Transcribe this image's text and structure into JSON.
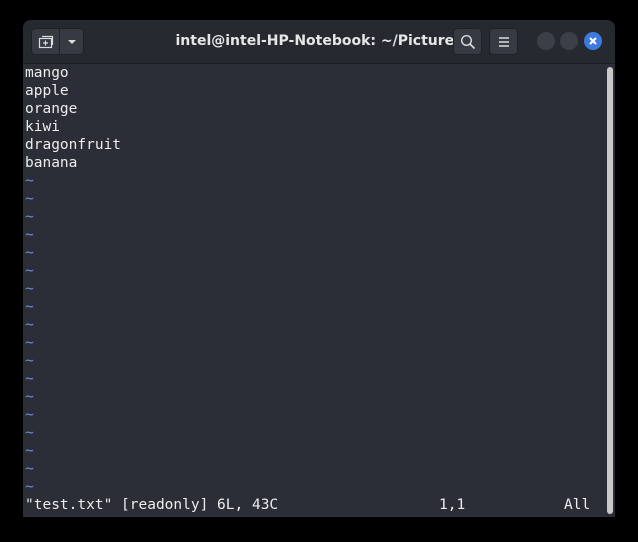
{
  "window": {
    "title": "intel@intel-HP-Notebook: ~/Pictures"
  },
  "titlebar": {
    "new_tab_icon": "new-tab-icon",
    "menu_dropdown_icon": "chevron-down-icon",
    "search_icon": "search-icon",
    "hamburger_icon": "hamburger-menu-icon",
    "close_icon": "close-icon",
    "accent_color": "#3d7ae0"
  },
  "editor": {
    "lines": [
      "mango",
      "apple",
      "orange",
      "kiwi",
      "dragonfruit",
      "banana"
    ],
    "empty_line_marker": "~",
    "empty_line_count": 18,
    "tilde_color": "#6b8fd6"
  },
  "statusline": {
    "file_info": "\"test.txt\" [readonly] 6L, 43C",
    "cursor_position": "1,1",
    "scroll_position": "All"
  }
}
